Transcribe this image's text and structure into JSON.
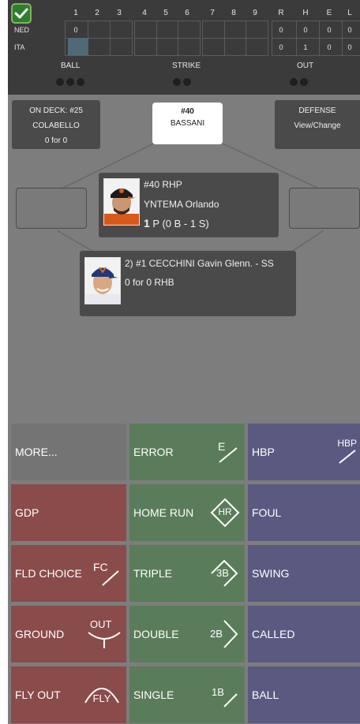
{
  "scoreboard": {
    "innings": [
      "1",
      "2",
      "3",
      "4",
      "5",
      "6",
      "7",
      "8",
      "9"
    ],
    "totals_headers": [
      "R",
      "H",
      "E",
      "L"
    ],
    "teams": [
      {
        "abbr": "NED",
        "inning_scores": [
          "0",
          "",
          "",
          "",
          "",
          "",
          "",
          "",
          ""
        ],
        "totals": [
          "0",
          "0",
          "0",
          "0"
        ]
      },
      {
        "abbr": "ITA",
        "inning_scores": [
          "",
          "",
          "",
          "",
          "",
          "",
          "",
          "",
          ""
        ],
        "totals": [
          "0",
          "1",
          "0",
          "0"
        ]
      }
    ],
    "count_labels": {
      "ball": "BALL",
      "strike": "STRIKE",
      "out": "OUT"
    },
    "counts": {
      "balls": 3,
      "strikes": 2,
      "outs": 2
    }
  },
  "on_deck": {
    "line1": "ON DECK: #25",
    "line2": "COLABELLO",
    "line3": "0 for 0"
  },
  "batter_top": {
    "number": "#40",
    "name": "BASSANI"
  },
  "defense": {
    "line1": "DEFENSE",
    "line2": "View/Change"
  },
  "pitcher": {
    "line1": "#40 RHP",
    "line2": "YNTEMA Orlando",
    "pitch_count": "1",
    "pitch_detail": "P (0 B - 1 S)"
  },
  "batter": {
    "line1": "2) #1 CECCHINI Gavin Glenn. - SS",
    "line2": "0 for 0 RHB"
  },
  "actions": {
    "more": "MORE...",
    "error": "ERROR",
    "error_badge": "E",
    "hbp": "HBP",
    "hbp_badge": "HBP",
    "gdp": "GDP",
    "home_run": "HOME RUN",
    "home_run_badge": "HR",
    "foul": "FOUL",
    "fld_choice": "FLD CHOICE",
    "fld_choice_badge": "FC",
    "triple": "TRIPLE",
    "triple_badge": "3B",
    "swing": "SWING",
    "ground": "GROUND",
    "ground_badge": "OUT",
    "double": "DOUBLE",
    "double_badge": "2B",
    "called": "CALLED",
    "fly_out": "FLY OUT",
    "fly_out_badge": "FLY",
    "single": "SINGLE",
    "single_badge": "1B",
    "ball": "BALL"
  },
  "colors": {
    "gray": "#747474",
    "red": "#8a4b4b",
    "green": "#5a7c5a",
    "purple": "#5a5a80",
    "scoreboard": "#3b3b3b"
  }
}
